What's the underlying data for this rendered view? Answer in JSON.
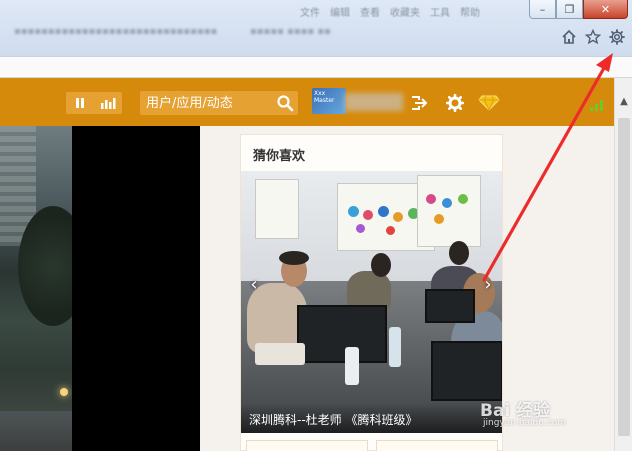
{
  "browser": {
    "window_controls": {
      "minimize": "–",
      "restore": "❐",
      "close": "✕"
    },
    "menu_items": [
      "文件",
      "编辑",
      "查看",
      "收藏夹",
      "工具",
      "帮助"
    ],
    "toolbar_icons": [
      "home-icon",
      "favorites-star-icon",
      "tools-gear-icon"
    ]
  },
  "site_header": {
    "search_placeholder": "用户/应用/动态",
    "avatar_text": "Xxx Master",
    "icons": [
      "pause-icon",
      "bar-chart-icon",
      "search-icon",
      "logout-arrow-icon",
      "settings-gear-icon",
      "diamond-icon",
      "signal-icon"
    ],
    "colors": {
      "bar": "#d58a0c",
      "accent": "#e6a133",
      "diamond": "#f4c21b",
      "signal": "#6cc82b"
    }
  },
  "recommend_card": {
    "title": "猜你喜欢",
    "slide_caption": "深圳腾科--杜老师 《腾科班级》",
    "prev_label": "‹",
    "next_label": "›"
  },
  "overlays": {
    "watermark_main": "Bai 经验",
    "watermark_sub": "jingyan.baidu.com",
    "annotation_arrow_color": "#ee2b2b"
  }
}
